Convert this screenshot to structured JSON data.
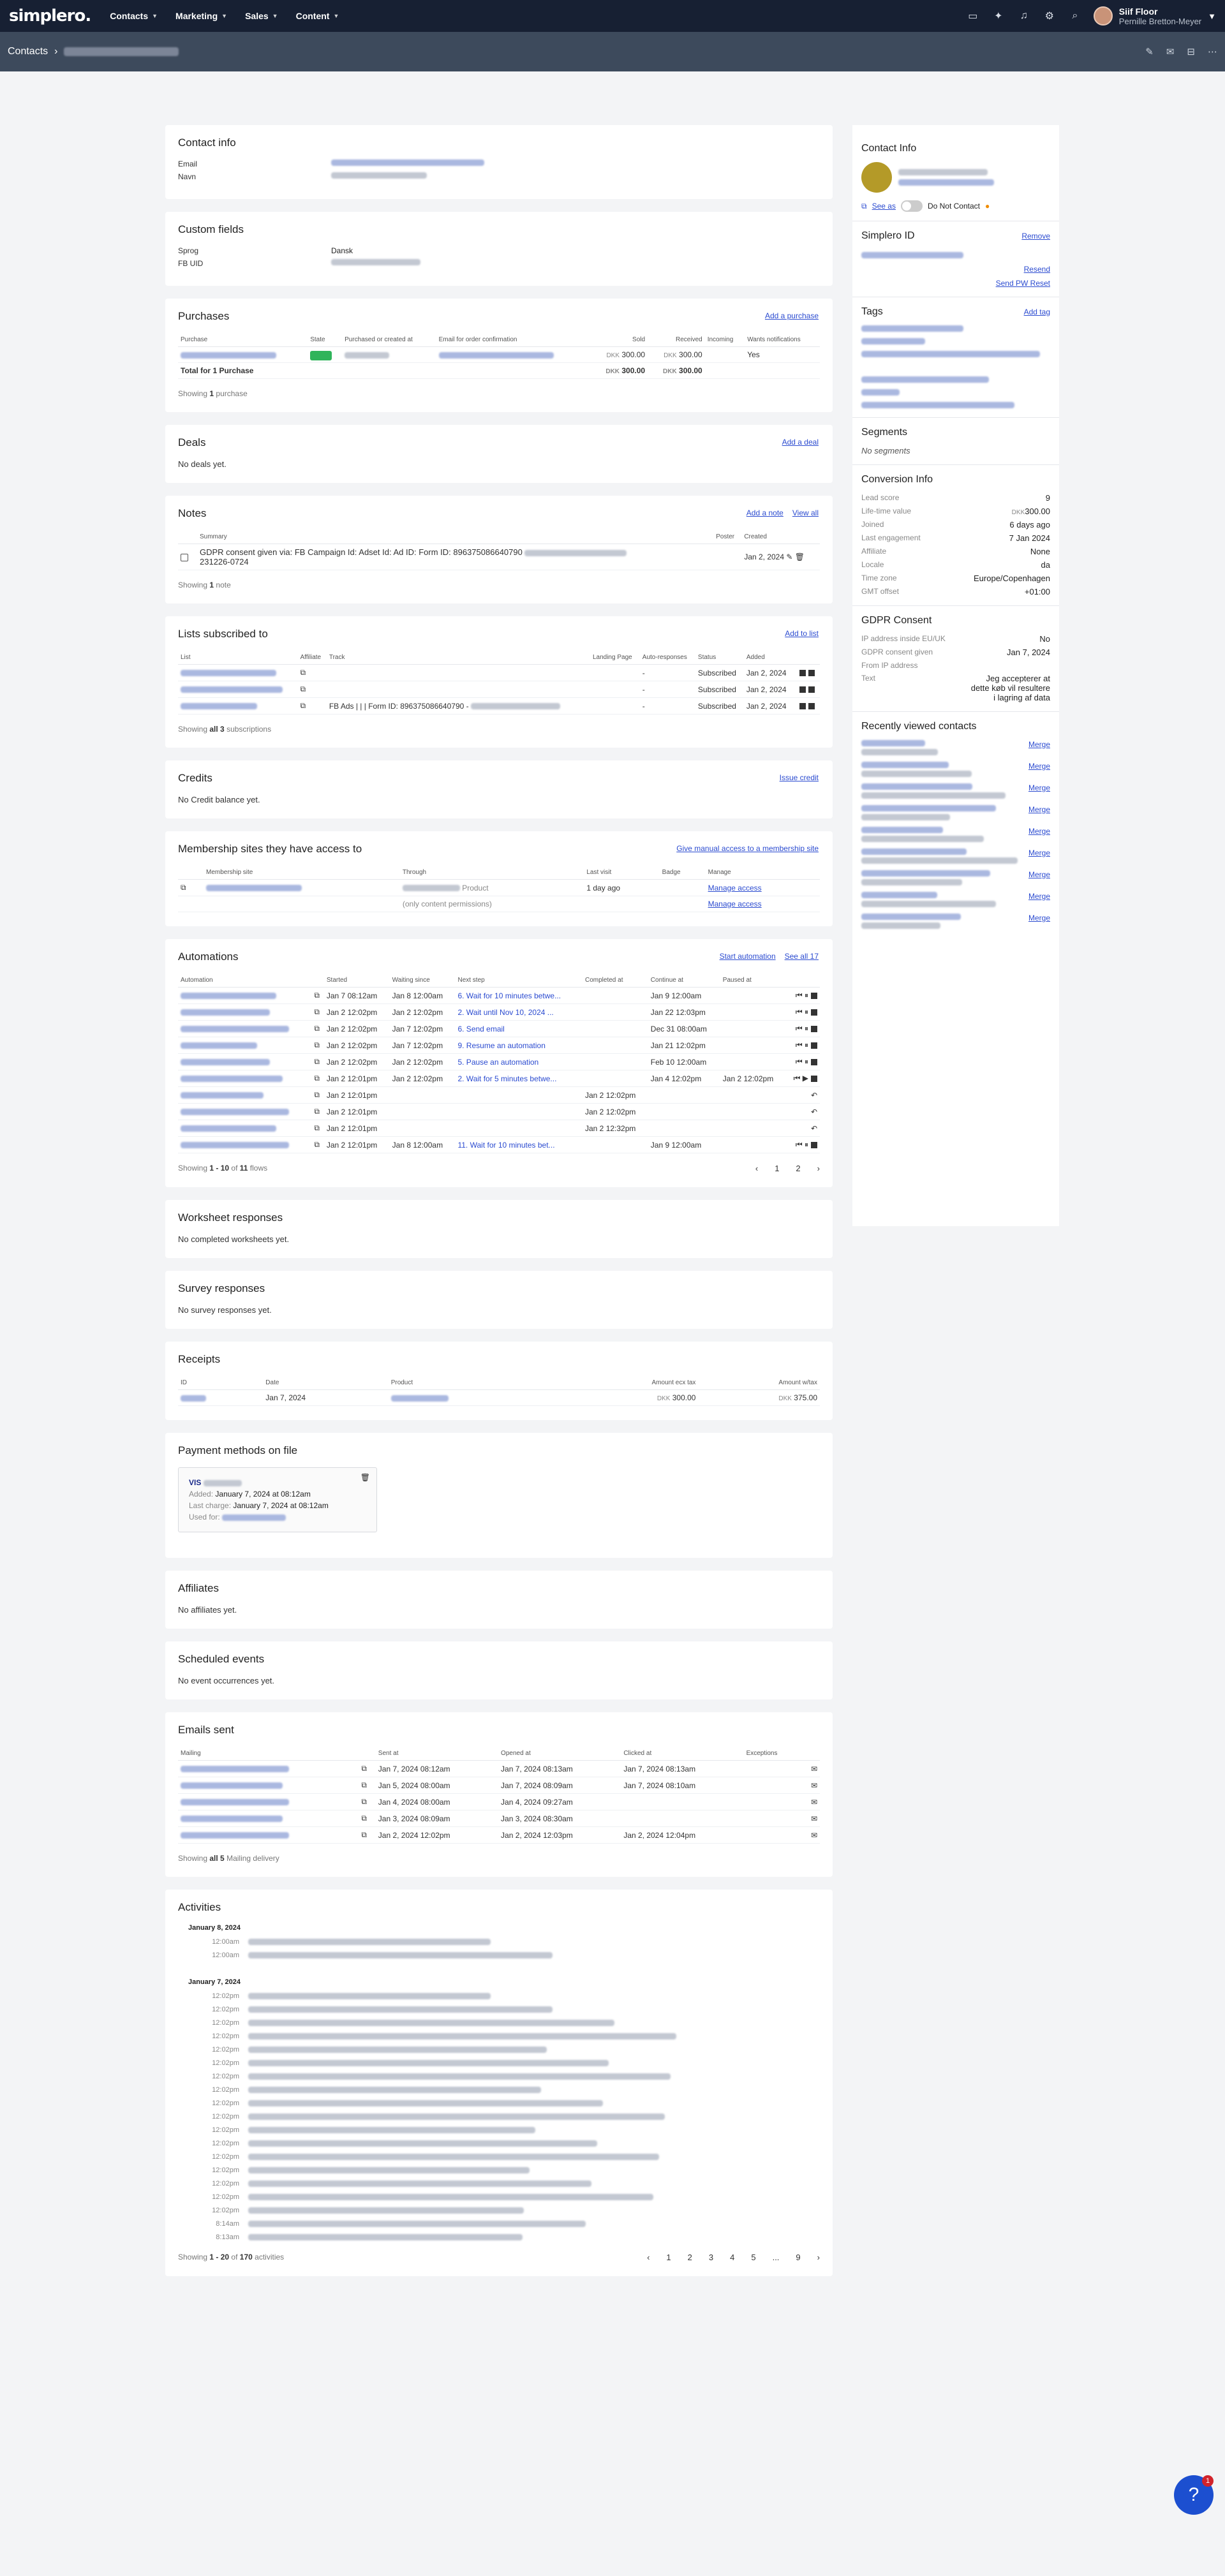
{
  "nav": {
    "logo": "simplero.",
    "items": [
      "Contacts",
      "Marketing",
      "Sales",
      "Content"
    ],
    "user_name": "Siif Floor",
    "user_sub": "Pernille Bretton-Meyer"
  },
  "crumb": {
    "root": "Contacts"
  },
  "contact_info": {
    "title": "Contact info",
    "email_label": "Email",
    "name_label": "Navn"
  },
  "custom": {
    "title": "Custom fields",
    "rows": [
      {
        "k": "Sprog",
        "v": "Dansk"
      },
      {
        "k": "FB UID",
        "v": ""
      }
    ]
  },
  "purchases": {
    "title": "Purchases",
    "add": "Add a purchase",
    "cols": [
      "Purchase",
      "State",
      "Purchased or created at",
      "Email for order confirmation",
      "Sold",
      "Received",
      "Incoming",
      "Wants notifications"
    ],
    "sold": "300.00",
    "received": "300.00",
    "yes": "Yes",
    "total_label": "Total for 1 Purchase",
    "total_sold": "300.00",
    "total_received": "300.00",
    "currency": "DKK",
    "showing": "Showing",
    "showing_n": "1",
    "showing_w": "purchase"
  },
  "deals": {
    "title": "Deals",
    "add": "Add a deal",
    "empty": "No deals yet."
  },
  "notes": {
    "title": "Notes",
    "add": "Add a note",
    "all": "View all",
    "cols": [
      "Summary",
      "Poster",
      "Created"
    ],
    "summary": "GDPR consent given via: FB Campaign Id: Adset Id: Ad ID: Form ID: 896375086640790",
    "summary2": "231226-0724",
    "created": "Jan 2, 2024",
    "showing": "Showing",
    "n": "1",
    "w": "note"
  },
  "lists": {
    "title": "Lists subscribed to",
    "add": "Add to list",
    "cols": [
      "List",
      "Affiliate",
      "Track",
      "Landing Page",
      "Auto-responses",
      "Status",
      "Added"
    ],
    "rows": [
      {
        "track": "",
        "auto": "-",
        "status": "Subscribed",
        "added": "Jan 2, 2024"
      },
      {
        "track": "",
        "auto": "-",
        "status": "Subscribed",
        "added": "Jan 2, 2024"
      },
      {
        "track": "FB Ads | | | Form ID: 896375086640790 -",
        "auto": "-",
        "status": "Subscribed",
        "added": "Jan 2, 2024"
      }
    ],
    "showing": "Showing",
    "n": "all 3",
    "w": "subscriptions"
  },
  "credits": {
    "title": "Credits",
    "issue": "Issue credit",
    "empty": "No Credit balance yet."
  },
  "membership": {
    "title": "Membership sites they have access to",
    "give": "Give manual access to a membership site",
    "cols": [
      "Membership site",
      "Through",
      "Last visit",
      "Badge",
      "Manage"
    ],
    "product": "Product",
    "last": "1 day ago",
    "manage": "Manage access",
    "only": "(only content permissions)",
    "manage2": "Manage access"
  },
  "automations": {
    "title": "Automations",
    "start": "Start automation",
    "all": "See all 17",
    "cols": [
      "Automation",
      "Started",
      "Waiting since",
      "Next step",
      "Completed at",
      "Continue at",
      "Paused at"
    ],
    "rows": [
      {
        "s": "Jan 7 08:12am",
        "w": "Jan 8 12:00am",
        "n": "6. Wait for 10 minutes betwe...",
        "c": "",
        "ca": "Jan 9 12:00am",
        "p": ""
      },
      {
        "s": "Jan 2 12:02pm",
        "w": "Jan 2 12:02pm",
        "n": "2. Wait until Nov 10, 2024 ...",
        "c": "",
        "ca": "Jan 22 12:03pm",
        "p": ""
      },
      {
        "s": "Jan 2 12:02pm",
        "w": "Jan 7 12:02pm",
        "n": "6. Send email",
        "c": "",
        "ca": "Dec 31 08:00am",
        "p": ""
      },
      {
        "s": "Jan 2 12:02pm",
        "w": "Jan 7 12:02pm",
        "n": "9. Resume an automation",
        "c": "",
        "ca": "Jan 21 12:02pm",
        "p": ""
      },
      {
        "s": "Jan 2 12:02pm",
        "w": "Jan 2 12:02pm",
        "n": "5. Pause an automation",
        "c": "",
        "ca": "Feb 10 12:00am",
        "p": ""
      },
      {
        "s": "Jan 2 12:01pm",
        "w": "Jan 2 12:02pm",
        "n": "2. Wait for 5 minutes betwe...",
        "c": "",
        "ca": "Jan 4 12:02pm",
        "p": "Jan 2 12:02pm"
      },
      {
        "s": "Jan 2 12:01pm",
        "w": "",
        "n": "",
        "c": "Jan 2 12:02pm",
        "ca": "",
        "p": ""
      },
      {
        "s": "Jan 2 12:01pm",
        "w": "",
        "n": "",
        "c": "Jan 2 12:02pm",
        "ca": "",
        "p": ""
      },
      {
        "s": "Jan 2 12:01pm",
        "w": "",
        "n": "",
        "c": "Jan 2 12:32pm",
        "ca": "",
        "p": ""
      },
      {
        "s": "Jan 2 12:01pm",
        "w": "Jan 8 12:00am",
        "n": "11. Wait for 10 minutes bet...",
        "c": "",
        "ca": "Jan 9 12:00am",
        "p": ""
      }
    ],
    "showing": "Showing",
    "n": "1 - 10",
    "of": "of",
    "total": "11",
    "w": "flows",
    "pages": [
      "1",
      "2"
    ]
  },
  "worksheet": {
    "title": "Worksheet responses",
    "empty": "No completed worksheets yet."
  },
  "survey": {
    "title": "Survey responses",
    "empty": "No survey responses yet."
  },
  "receipts": {
    "title": "Receipts",
    "cols": [
      "ID",
      "Date",
      "Product",
      "Amount ecx tax",
      "Amount w/tax"
    ],
    "date": "Jan 7, 2024",
    "ex": "300.00",
    "inc": "375.00",
    "currency": "DKK"
  },
  "payment": {
    "title": "Payment methods on file",
    "brand": "VIS",
    "added_l": "Added:",
    "added": "January 7, 2024 at 08:12am",
    "last_l": "Last charge:",
    "last": "January 7, 2024 at 08:12am",
    "used_l": "Used for:"
  },
  "affiliates": {
    "title": "Affiliates",
    "empty": "No affiliates yet."
  },
  "scheduled": {
    "title": "Scheduled events",
    "empty": "No event occurrences yet."
  },
  "emails": {
    "title": "Emails sent",
    "cols": [
      "Mailing",
      "Sent at",
      "Opened at",
      "Clicked at",
      "Exceptions"
    ],
    "rows": [
      {
        "s": "Jan 7, 2024 08:12am",
        "o": "Jan 7, 2024 08:13am",
        "c": "Jan 7, 2024 08:13am"
      },
      {
        "s": "Jan 5, 2024 08:00am",
        "o": "Jan 7, 2024 08:09am",
        "c": "Jan 7, 2024 08:10am"
      },
      {
        "s": "Jan 4, 2024 08:00am",
        "o": "Jan 4, 2024 09:27am",
        "c": ""
      },
      {
        "s": "Jan 3, 2024 08:09am",
        "o": "Jan 3, 2024 08:30am",
        "c": ""
      },
      {
        "s": "Jan 2, 2024 12:02pm",
        "o": "Jan 2, 2024 12:03pm",
        "c": "Jan 2, 2024 12:04pm"
      }
    ],
    "showing": "Showing",
    "n": "all 5",
    "w": "Mailing delivery"
  },
  "activities": {
    "title": "Activities",
    "d1": "January 8, 2024",
    "t1": [
      "12:00am",
      "12:00am"
    ],
    "d2": "January 7, 2024",
    "t2": [
      "12:02pm",
      "12:02pm",
      "12:02pm",
      "12:02pm",
      "12:02pm",
      "12:02pm",
      "12:02pm",
      "12:02pm",
      "12:02pm",
      "12:02pm",
      "12:02pm",
      "12:02pm",
      "12:02pm",
      "12:02pm",
      "12:02pm",
      "12:02pm",
      "12:02pm",
      "8:14am"
    ],
    "t3": "8:13am",
    "showing": "Showing",
    "n": "1 - 20",
    "of": "of",
    "total": "170",
    "w": "activities",
    "pages": [
      "1",
      "2",
      "3",
      "4",
      "5",
      "...",
      "9"
    ]
  },
  "side": {
    "title": "Contact Info",
    "see_as": "See as",
    "dnc": "Do Not Contact",
    "id_title": "Simplero ID",
    "remove": "Remove",
    "resend": "Resend",
    "send_pw": "Send PW Reset",
    "tags_title": "Tags",
    "add_tag": "Add tag",
    "segments": "Segments",
    "no_segments": "No segments",
    "conv_title": "Conversion Info",
    "conv": [
      {
        "k": "Lead score",
        "v": "9"
      },
      {
        "k": "Life-time value",
        "v": "300.00",
        "cur": "DKK"
      },
      {
        "k": "Joined",
        "v": "6 days ago"
      },
      {
        "k": "Last engagement",
        "v": "7 Jan 2024"
      },
      {
        "k": "Affiliate",
        "v": "None"
      },
      {
        "k": "Locale",
        "v": "da"
      },
      {
        "k": "Time zone",
        "v": "Europe/Copenhagen"
      },
      {
        "k": "GMT offset",
        "v": "+01:00"
      }
    ],
    "gdpr_title": "GDPR Consent",
    "gdpr": [
      {
        "k": "IP address inside EU/UK",
        "v": "No"
      },
      {
        "k": "GDPR consent given",
        "v": "Jan 7, 2024"
      },
      {
        "k": "From IP address",
        "v": ""
      }
    ],
    "text_label": "Text",
    "text": "Jeg accepterer at dette køb vil resultere i lagring af data",
    "recent_title": "Recently viewed contacts",
    "merge": "Merge"
  },
  "help": {
    "count": "1"
  }
}
